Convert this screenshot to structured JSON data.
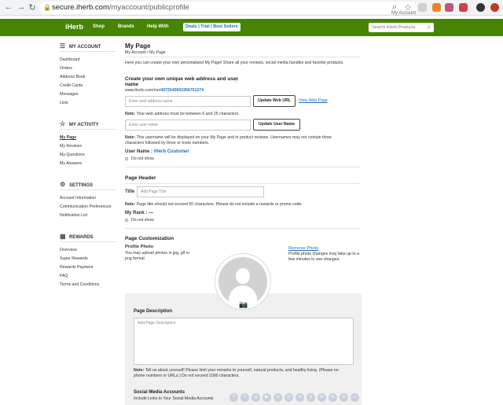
{
  "browser": {
    "back_icon": "back-arrow-icon",
    "url_host": "secure.iherb.com",
    "url_path": "/myaccount/publicprofile"
  },
  "topbar": {
    "account": "My Account"
  },
  "nav": {
    "logo": "iHerb",
    "shop": "Shop",
    "brands": "Brands",
    "help": "Help With",
    "deals": "Deals",
    "trial": "Trial",
    "best_sellers": "Best Sellers",
    "search_placeholder": "Search iHerb Products"
  },
  "sidebar": {
    "account_header": "MY ACCOUNT",
    "account_items": [
      "Dashboard",
      "Orders",
      "Address Book",
      "Credit Cards",
      "Messages",
      "Lists"
    ],
    "activity_header": "MY ACTIVITY",
    "activity_items": [
      "My Page",
      "My Reviews",
      "My Questions",
      "My Answers"
    ],
    "settings_header": "SETTINGS",
    "settings_items": [
      "Account Information",
      "Communication Preferences",
      "Notification List"
    ],
    "rewards_header": "REWARDS",
    "rewards_items": [
      "Overview",
      "Super Rewards",
      "Rewards Payment",
      "FAQ",
      "Terms and Conditions"
    ]
  },
  "main": {
    "title": "My Page",
    "breadcrumb": "My Account  /  My Page",
    "intro": "Here you can create your own personalized My Page! Share all your reviews, social media handles and favorite products.",
    "web_heading_1": "Create your own unique web address and user",
    "web_heading_2": "name",
    "url_prefix": "www.iherb.com/me/",
    "url_id": "4972540601956701274",
    "web_placeholder": "Enter web address name",
    "update_url": "Update Web URL",
    "view_page": "View Web Page",
    "web_note_label": "Note:",
    "web_note": "Your web address must be between 6 and 25 characters.",
    "user_placeholder": "Enter user name",
    "update_user": "Update User Name",
    "user_note_label": "Note:",
    "user_note_1": "This username will be displayed on your My Page and in product reviews. Usernames may not contain three",
    "user_note_2": "characters followed by three or more numbers.",
    "user_name_label": "User Name :",
    "user_name_value": "iHerb Customer",
    "do_not_show_1": "Do not show",
    "header_heading": "Page Header",
    "title_label": "Title",
    "title_placeholder": "Add Page Title",
    "title_note_label": "Note:",
    "title_note": "Page title should not exceed 50 characters. Please do not include a rewards or promo code.",
    "rank_label": "My Rank :",
    "rank_value": "—",
    "do_not_show_2": "Do not show",
    "custom_heading": "Page Customization",
    "photo_label": "Profile Photo",
    "photo_help_1": "You may upload photos in jpg, gif or",
    "photo_help_2": "png format",
    "remove_photo": "Remove Photo",
    "photo_note_1": "Profile photo changes may take up to a",
    "photo_note_2": "few minutes to see changes.",
    "desc_heading": "Page Description",
    "desc_placeholder": "Add Page Description",
    "desc_note_label": "Note:",
    "desc_note_1": "Tell us about yourself! Please limit your remarks to yourself, natural products, and healthy living. (Please no",
    "desc_note_2": "phone numbers or URLs.) Do not exceed 1000 characters.",
    "social_heading": "Social Media Accounts",
    "social_sub": "Include Links to Your Social Media Accounts"
  },
  "social_icons": [
    "facebook-icon",
    "twitter-icon",
    "google-plus-icon",
    "youtube-icon",
    "vk-icon",
    "instagram-icon",
    "ok-icon",
    "pinterest-icon",
    "linkedin-icon",
    "weibo-icon",
    "blog-icon",
    "website-icon"
  ]
}
